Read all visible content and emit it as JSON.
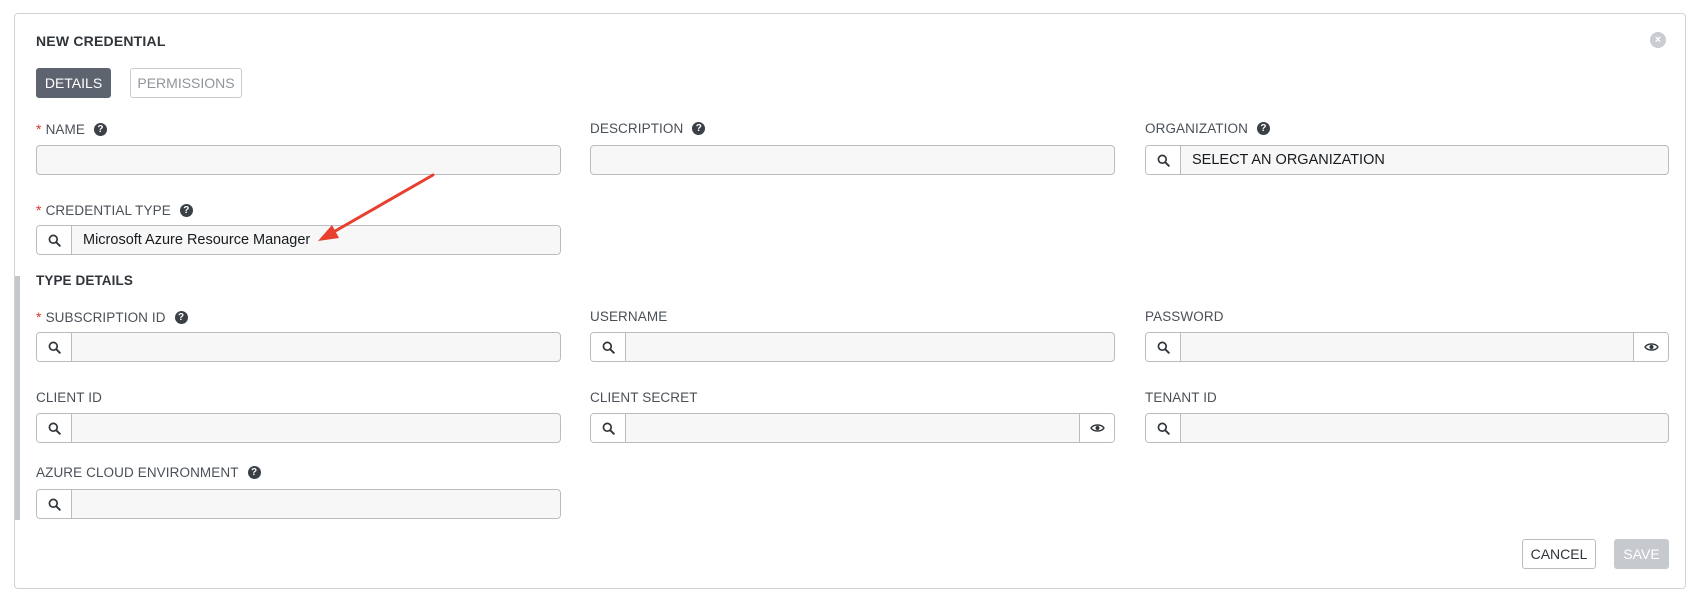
{
  "header": {
    "title": "NEW CREDENTIAL",
    "close_icon": "times-circle-icon"
  },
  "tabs": [
    {
      "label": "DETAILS",
      "active": true
    },
    {
      "label": "PERMISSIONS",
      "active": false
    }
  ],
  "fields": {
    "name": {
      "label": "NAME",
      "required": true,
      "value": ""
    },
    "description": {
      "label": "DESCRIPTION",
      "required": false,
      "value": ""
    },
    "organization": {
      "label": "ORGANIZATION",
      "required": false,
      "value": "SELECT AN ORGANIZATION"
    },
    "credential_type": {
      "label": "CREDENTIAL TYPE",
      "required": true,
      "value": "Microsoft Azure Resource Manager"
    }
  },
  "type_details": {
    "title": "TYPE DETAILS",
    "subscription_id": {
      "label": "SUBSCRIPTION ID",
      "required": true,
      "value": ""
    },
    "username": {
      "label": "USERNAME",
      "value": ""
    },
    "password": {
      "label": "PASSWORD",
      "value": ""
    },
    "client_id": {
      "label": "CLIENT ID",
      "value": ""
    },
    "client_secret": {
      "label": "CLIENT SECRET",
      "value": ""
    },
    "tenant_id": {
      "label": "TENANT ID",
      "value": ""
    },
    "azure_cloud_environment": {
      "label": "AZURE CLOUD ENVIRONMENT",
      "value": ""
    }
  },
  "actions": {
    "cancel_label": "CANCEL",
    "save_label": "SAVE"
  },
  "help_glyph": "?",
  "required_glyph": "*",
  "colors": {
    "active_tab": "#5d6470",
    "required_marker": "#d9342b",
    "annotation_arrow": "#e8402e",
    "save_disabled": "#c6c9cd"
  },
  "icons": [
    "search-icon",
    "question-circle-icon",
    "eye-icon",
    "times-circle-icon"
  ]
}
